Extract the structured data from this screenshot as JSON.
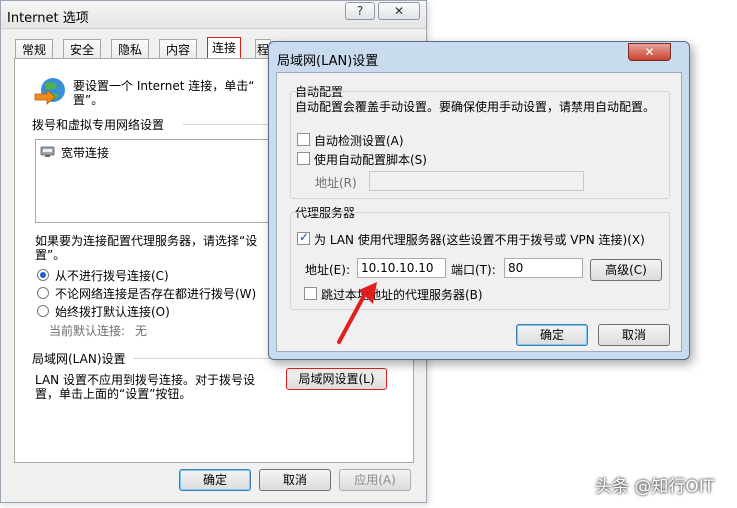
{
  "inet": {
    "title": "Internet 选项",
    "help_label": "?",
    "close_label": "✕",
    "tabs": [
      "常规",
      "安全",
      "隐私",
      "内容",
      "连接",
      "程"
    ],
    "setup_text_line1": "要设置一个 Internet 连接，单击“",
    "setup_text_line2": "置”。",
    "dialup_heading": "拨号和虚拟专用网络设置",
    "dialup_items": [
      "宽带连接"
    ],
    "proxy_text_line1": "如果要为连接配置代理服务器，请选择“设",
    "proxy_text_line2": "置”。",
    "radio_options": [
      {
        "label": "从不进行拨号连接(C)",
        "checked": true
      },
      {
        "label": "不论网络连接是否存在都进行拨号(W)",
        "checked": false
      },
      {
        "label": "始终拨打默认连接(O)",
        "checked": false
      }
    ],
    "current_default_label": "当前默认连接:",
    "current_default_value": "无",
    "lan_heading": "局域网(LAN)设置",
    "lan_text_line1": "LAN 设置不应用到拨号连接。对于拨号设",
    "lan_text_line2": "置，单击上面的“设置”按钮。",
    "lan_settings_button": "局域网设置(L)",
    "ok_button": "确定",
    "cancel_button": "取消",
    "apply_button": "应用(A)"
  },
  "lan": {
    "title": "局域网(LAN)设置",
    "close_label": "✕",
    "auto_config_heading": "自动配置",
    "auto_config_desc": "自动配置会覆盖手动设置。要确保使用手动设置，请禁用自动配置。",
    "auto_detect_label": "自动检测设置(A)",
    "auto_detect_checked": false,
    "use_script_label": "使用自动配置脚本(S)",
    "use_script_checked": false,
    "script_address_label": "地址(R)",
    "script_address_value": "",
    "proxy_heading": "代理服务器",
    "use_proxy_label": "为 LAN 使用代理服务器(这些设置不用于拨号或 VPN 连接)(X)",
    "use_proxy_checked": true,
    "address_label": "地址(E):",
    "address_value": "10.10.10.10",
    "port_label": "端口(T):",
    "port_value": "80",
    "advanced_button": "高级(C)",
    "bypass_label": "跳过本地地址的代理服务器(B)",
    "bypass_checked": false,
    "ok_button": "确定",
    "cancel_button": "取消"
  },
  "watermark": "头条 @知行OIT",
  "colors": {
    "annotation_red": "#e02020",
    "lan_frame": "#c9dcef",
    "checkbox_accent": "#1c4e9c"
  }
}
